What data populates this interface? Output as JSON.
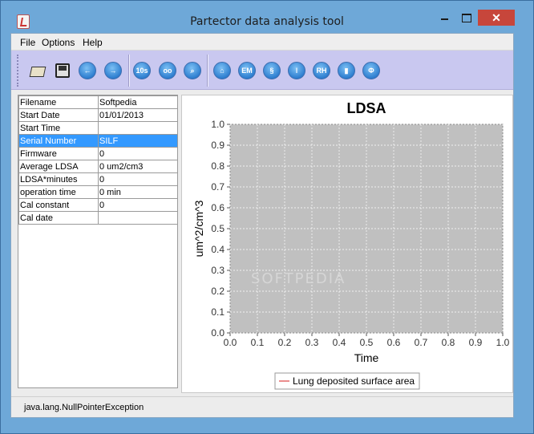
{
  "window": {
    "title": "Partector data analysis tool",
    "close_glyph": "✕"
  },
  "menu": [
    "File",
    "Options",
    "Help"
  ],
  "toolbar": {
    "buttons": [
      {
        "icon": "open-folder-icon",
        "label": ""
      },
      {
        "icon": "save-floppy-icon",
        "label": ""
      },
      {
        "icon": "arrow-left-icon",
        "label": "←"
      },
      {
        "icon": "arrow-right-icon",
        "label": "→"
      },
      {
        "icon": "ten-seconds-icon",
        "label": "10s"
      },
      {
        "icon": "glasses-icon",
        "label": "oo"
      },
      {
        "icon": "magnifier-icon",
        "label": "⌕"
      },
      {
        "icon": "lungs-icon",
        "label": "⌂"
      },
      {
        "icon": "em-icon",
        "label": "EM"
      },
      {
        "icon": "s-curve-icon",
        "label": "§"
      },
      {
        "icon": "thermometer-icon",
        "label": "ǀ"
      },
      {
        "icon": "rh-icon",
        "label": "RH"
      },
      {
        "icon": "battery-icon",
        "label": "▮"
      },
      {
        "icon": "phi-icon",
        "label": "Φ"
      }
    ]
  },
  "properties": [
    {
      "key": "Filename",
      "value": "Softpedia"
    },
    {
      "key": "Start Date",
      "value": "01/01/2013"
    },
    {
      "key": "Start Time",
      "value": ""
    },
    {
      "key": "Serial Number",
      "value": "SILF",
      "selected": true
    },
    {
      "key": "Firmware",
      "value": "0"
    },
    {
      "key": "Average LDSA",
      "value": "0 um2/cm3"
    },
    {
      "key": "LDSA*minutes",
      "value": "0"
    },
    {
      "key": "operation time",
      "value": "0 min"
    },
    {
      "key": "Cal constant",
      "value": "0"
    },
    {
      "key": "Cal date",
      "value": ""
    }
  ],
  "chart_data": {
    "type": "line",
    "title": "LDSA",
    "xlabel": "Time",
    "ylabel": "um^2/cm^3",
    "xlim": [
      0.0,
      1.0
    ],
    "ylim": [
      0.0,
      1.0
    ],
    "x_ticks": [
      "0.0",
      "0.1",
      "0.2",
      "0.3",
      "0.4",
      "0.5",
      "0.6",
      "0.7",
      "0.8",
      "0.9",
      "1.0"
    ],
    "y_ticks": [
      "0.0",
      "0.1",
      "0.2",
      "0.3",
      "0.4",
      "0.5",
      "0.6",
      "0.7",
      "0.8",
      "0.9",
      "1.0"
    ],
    "grid": true,
    "plot_background": "#c0c0c0",
    "series": [
      {
        "name": "Lung deposited surface area",
        "color": "#e05050",
        "x": [],
        "y": []
      }
    ],
    "legend_position": "bottom"
  },
  "watermark": "SOFTPEDIA",
  "status": "java.lang.NullPointerException",
  "colors": {
    "title_bar": "#6ea8d8",
    "toolbar": "#c9c8f0",
    "selection": "#3399ff",
    "close_button": "#c7463b"
  }
}
